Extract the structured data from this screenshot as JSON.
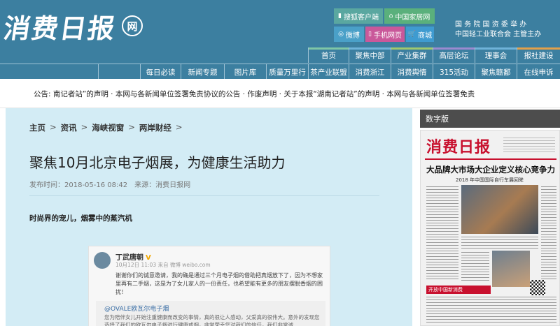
{
  "header": {
    "logo_text": "消费日报",
    "logo_badge": "网",
    "quick_links": [
      "搜狐客户端",
      "中国家居网",
      "微博",
      "手机网页",
      "商城"
    ],
    "sponsor_line1": "国 务 院 国 资 委 举    办",
    "sponsor_line2": "中国轻工业联合会   主管主办"
  },
  "nav": {
    "top": [
      "首页",
      "聚焦中部",
      "产业集群",
      "高层论坛",
      "理事会",
      "报社建设"
    ],
    "bottom": [
      "每日必读",
      "新闻专题",
      "图片库",
      "质量万里行",
      "茶产业联盟",
      "消费浙江",
      "消费舆情",
      "315活动",
      "聚焦赣鄱",
      "在线申诉"
    ]
  },
  "notice": {
    "text": "公告: 南记者站”的声明   · 本网与各新闻单位签署免责协议的公告   · 作废声明   · 关于本报“湖南记者站”的声明   · 本网与各新闻单位签署免责"
  },
  "article": {
    "breadcrumb": [
      "主页",
      "资讯",
      "海峡视窗",
      "两岸财经"
    ],
    "breadcrumb_sep": ">",
    "title": "聚焦10月北京电子烟展，为健康生活助力",
    "date": "发布时间：2018-05-16 08:42",
    "source": "来源：消费日报网",
    "lead": "时尚界的宠儿，烟雾中的蒸汽机"
  },
  "weibo": {
    "name": "丁武唐朝",
    "verified": "V",
    "time": "10月12日 11:03 来自 微博 weibo.com",
    "body": "谢谢你们的诚意邀请，我的确是通过三个月电子烟的借助把真烟放下了，因为不想家里再有二手烟，这是为了女儿家人的一份责任，也希望能有更多的朋友摆脱香烟的困扰！",
    "repost_name": "@OVALE欧瓦尔电子烟",
    "repost_text": "您为陪伴女儿开始注重健康而改变的事情，真的很让人感动，父爱真的很伟大。意外的发现您选择了我们的欧瓦尔电子烟进行健康戒烟，非常荣幸您对我们的信任，我们非常诚"
  },
  "sidebar": {
    "title": "数字版",
    "paper_masthead": "消费日报",
    "paper_headline": "大品牌大市场大企业定义核心竞争力",
    "paper_sub": "2018 年中国国际自行车展回眸",
    "paper_bottom": "开放中国新消费"
  },
  "colors": {
    "header_bg": "#3c7fa0",
    "content_bg": "#d3ecf5",
    "paper_red": "#c8102e"
  }
}
